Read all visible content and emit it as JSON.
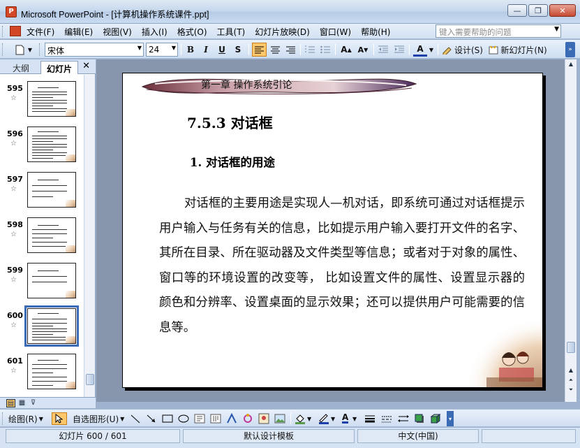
{
  "window": {
    "title": "Microsoft PowerPoint - [计算机操作系统课件.ppt]",
    "minimize": "—",
    "restore": "❐",
    "close": "✕"
  },
  "menu": {
    "items": [
      "文件(F)",
      "编辑(E)",
      "视图(V)",
      "插入(I)",
      "格式(O)",
      "工具(T)",
      "幻灯片放映(D)",
      "窗口(W)",
      "帮助(H)"
    ],
    "help_placeholder": "键入需要帮助的问题"
  },
  "toolbar": {
    "font_name": "宋体",
    "font_size": "24",
    "bold": "B",
    "italic": "I",
    "underline": "U",
    "shadow": "S",
    "design_label": "设计(S)",
    "new_slide_label": "新幻灯片(N)"
  },
  "left_pane": {
    "tab_outline": "大纲",
    "tab_slides": "幻灯片",
    "close": "✕",
    "slides": [
      {
        "num": "595",
        "star": "☆"
      },
      {
        "num": "596",
        "star": "☆"
      },
      {
        "num": "597",
        "star": "☆"
      },
      {
        "num": "598",
        "star": "☆"
      },
      {
        "num": "599",
        "star": "☆"
      },
      {
        "num": "600",
        "star": "☆",
        "selected": true
      },
      {
        "num": "601",
        "star": "☆"
      }
    ]
  },
  "slide": {
    "banner": "第一章  操作系统引论",
    "heading": "7.5.3  对话框",
    "subheading": "1. 对话框的用途",
    "body": "对话框的主要用途是实现人—机对话，即系统可通过对话框提示用户输入与任务有关的信息，比如提示用户输入要打开文件的名字、其所在目录、所在驱动器及文件类型等信息；或者对于对象的属性、窗口等的环境设置的改变等， 比如设置文件的属性、设置显示器的颜色和分辨率、设置桌面的显示效果；还可以提供用户可能需要的信息等。"
  },
  "draw_toolbar": {
    "draw_label": "绘图(R)",
    "autoshapes_label": "自选图形(U)"
  },
  "status": {
    "slide_info": "幻灯片 600 / 601",
    "template": "默认设计模板",
    "language": "中文(中国)"
  },
  "colors": {
    "accent": "#3c6bb5",
    "title_bar": "#c4d6ec",
    "editor_bg": "#8795ad"
  }
}
